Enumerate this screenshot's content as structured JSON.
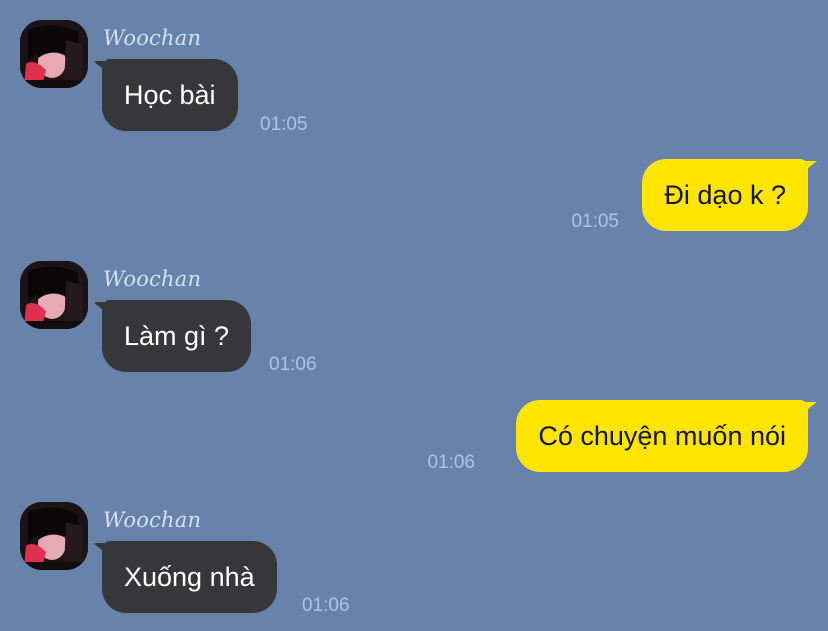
{
  "messages": [
    {
      "sender": "Woochan",
      "text": "Học bài",
      "time": "01:05",
      "avatar_icon": "avatar-icon"
    },
    {
      "text": "Đi dạo k ?",
      "time": "01:05"
    },
    {
      "sender": "Woochan",
      "text": "Làm gì ?",
      "time": "01:06",
      "avatar_icon": "avatar-icon"
    },
    {
      "text": "Có chuyện muốn nói",
      "time": "01:06"
    },
    {
      "sender": "Woochan",
      "text": "Xuống nhà",
      "time": "01:06",
      "avatar_icon": "avatar-icon"
    }
  ],
  "colors": {
    "background": "#6783ac",
    "incoming_bubble": "#373739",
    "outgoing_bubble": "#ffe500",
    "timestamp": "#b3c3dc",
    "sender_name": "#d6e0ef"
  }
}
